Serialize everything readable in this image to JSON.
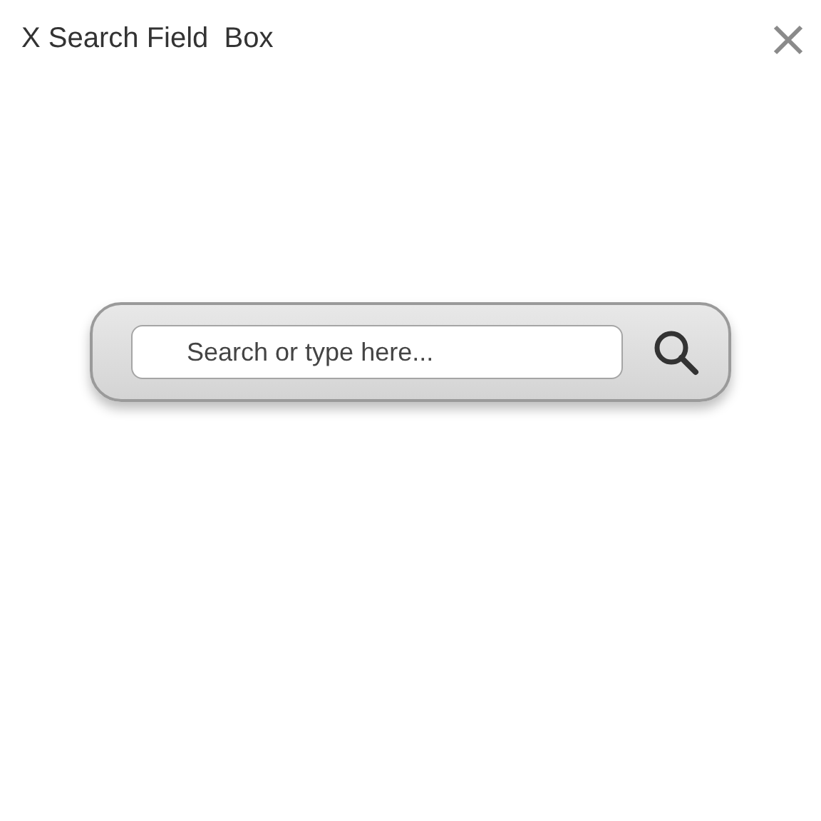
{
  "window": {
    "title": "X Search Field  Box"
  },
  "search": {
    "placeholder": "Search or type here..."
  }
}
